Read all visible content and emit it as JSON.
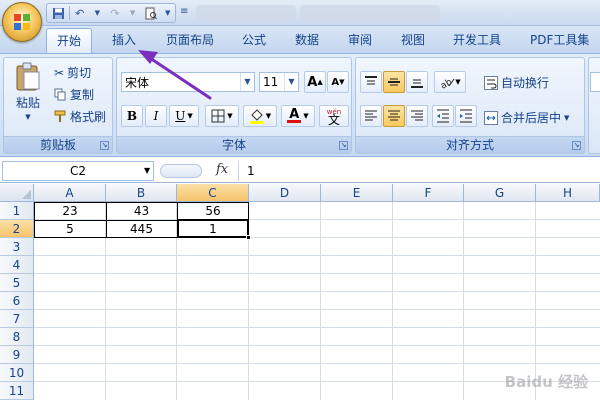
{
  "tabs": [
    {
      "label": "开始",
      "active": true
    },
    {
      "label": "插入"
    },
    {
      "label": "页面布局"
    },
    {
      "label": "公式"
    },
    {
      "label": "数据"
    },
    {
      "label": "审阅"
    },
    {
      "label": "视图"
    },
    {
      "label": "开发工具"
    },
    {
      "label": "PDF工具集"
    }
  ],
  "ribbon": {
    "clipboard": {
      "caption": "剪贴板",
      "paste": "粘贴",
      "cut": "剪切",
      "copy": "复制",
      "format_painter": "格式刷"
    },
    "font": {
      "caption": "字体",
      "font_name": "宋体",
      "font_size": "11",
      "bold": "B",
      "italic": "I",
      "underline": "U",
      "phonetic": "wén"
    },
    "alignment": {
      "caption": "对齐方式",
      "wrap_text": "自动换行",
      "merge_center": "合并后居中"
    }
  },
  "formula_bar": {
    "name_box": "C2",
    "fx": "fx",
    "formula": "1"
  },
  "grid": {
    "columns": [
      "A",
      "B",
      "C",
      "D",
      "E",
      "F",
      "G",
      "H"
    ],
    "selected_column": "C",
    "rows": [
      "1",
      "2",
      "3",
      "4",
      "5",
      "6",
      "7",
      "8",
      "9",
      "10",
      "11"
    ],
    "selected_row": "2",
    "cells": [
      [
        "23",
        "43",
        "56"
      ],
      [
        "5",
        "445",
        "1"
      ]
    ]
  },
  "colors": {
    "ribbon_text": "#15428b",
    "accent_selected": "#f5c46b",
    "annotation_arrow": "#7b2fbe"
  },
  "watermark": "Baidu 经验"
}
